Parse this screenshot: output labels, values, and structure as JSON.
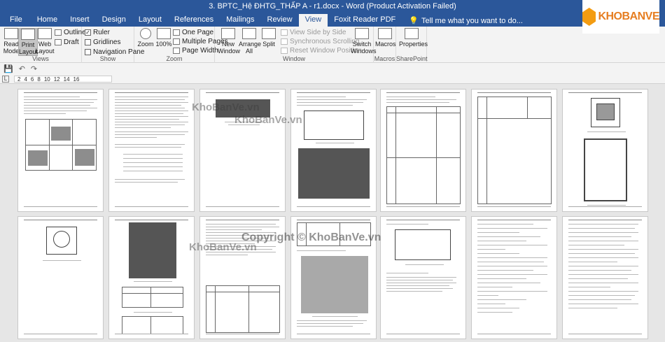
{
  "window": {
    "title": "3. BPTC_Hệ ĐHTG_THẤP A - r1.docx - Word (Product Activation Failed)"
  },
  "logo": {
    "text": "KHOBANVE"
  },
  "tabs": [
    {
      "label": "File"
    },
    {
      "label": "Home"
    },
    {
      "label": "Insert"
    },
    {
      "label": "Design"
    },
    {
      "label": "Layout"
    },
    {
      "label": "References"
    },
    {
      "label": "Mailings"
    },
    {
      "label": "Review"
    },
    {
      "label": "View"
    },
    {
      "label": "Foxit Reader PDF"
    }
  ],
  "tell_me": "Tell me what you want to do...",
  "ribbon": {
    "views": {
      "label": "Views",
      "read_mode": "Read Mode",
      "print_layout": "Print Layout",
      "web_layout": "Web Layout",
      "outline": "Outline",
      "draft": "Draft"
    },
    "show": {
      "label": "Show",
      "ruler": "Ruler",
      "gridlines": "Gridlines",
      "navigation_pane": "Navigation Pane"
    },
    "zoom": {
      "label": "Zoom",
      "zoom": "Zoom",
      "hundred": "100%",
      "one_page": "One Page",
      "multiple_pages": "Multiple Pages",
      "page_width": "Page Width"
    },
    "window": {
      "label": "Window",
      "new_window": "New Window",
      "arrange_all": "Arrange All",
      "split": "Split",
      "view_side_by_side": "View Side by Side",
      "synchronous_scrolling": "Synchronous Scrolling",
      "reset_window_position": "Reset Window Position",
      "switch_windows": "Switch Windows"
    },
    "macros": {
      "label": "Macros",
      "macros": "Macros"
    },
    "sharepoint": {
      "label": "SharePoint",
      "properties": "Properties"
    }
  },
  "ruler_marks": [
    "2",
    "4",
    "6",
    "8",
    "10",
    "12",
    "14",
    "16"
  ],
  "tab_selector": "L",
  "watermarks": [
    "KhoBanVe.vn",
    "KhoBanVe.vn",
    "KhoBanVe.vn"
  ],
  "copyright": "Copyright © KhoBanVe.vn"
}
